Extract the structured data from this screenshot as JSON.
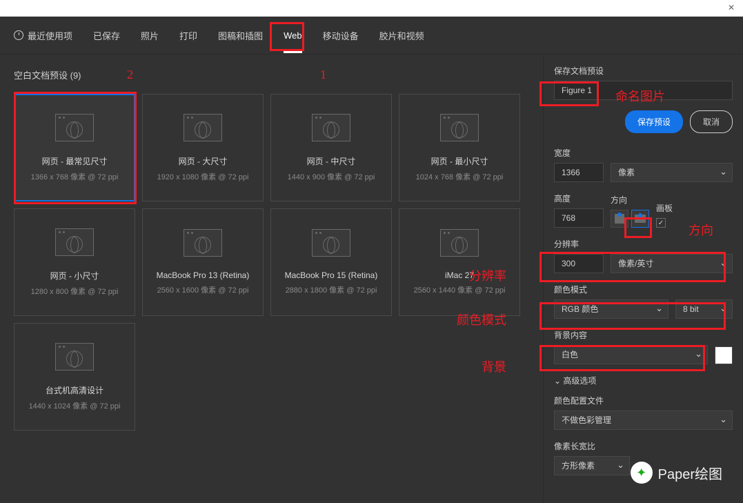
{
  "titlebar": {
    "close": "✕"
  },
  "tabs": {
    "recent": "最近使用项",
    "saved": "已保存",
    "photo": "照片",
    "print": "打印",
    "art": "图稿和插图",
    "web": "Web",
    "mobile": "移动设备",
    "film": "胶片和视频"
  },
  "section": {
    "title": "空白文档预设 (9)"
  },
  "presets": [
    {
      "title": "网页 - 最常见尺寸",
      "sub": "1366 x 768 像素 @ 72 ppi"
    },
    {
      "title": "网页 - 大尺寸",
      "sub": "1920 x 1080 像素 @ 72 ppi"
    },
    {
      "title": "网页 - 中尺寸",
      "sub": "1440 x 900 像素 @ 72 ppi"
    },
    {
      "title": "网页 - 最小尺寸",
      "sub": "1024 x 768 像素 @ 72 ppi"
    },
    {
      "title": "网页 - 小尺寸",
      "sub": "1280 x 800 像素 @ 72 ppi"
    },
    {
      "title": "MacBook Pro 13 (Retina)",
      "sub": "2560 x 1600 像素 @ 72 ppi"
    },
    {
      "title": "MacBook Pro 15 (Retina)",
      "sub": "2880 x 1800 像素 @ 72 ppi"
    },
    {
      "title": "iMac 27",
      "sub": "2560 x 1440 像素 @ 72 ppi"
    },
    {
      "title": "台式机高清设计",
      "sub": "1440 x 1024 像素 @ 72 ppi"
    }
  ],
  "panel": {
    "save_preset_label": "保存文档预设",
    "name": "Figure 1",
    "save_btn": "保存预设",
    "cancel_btn": "取消",
    "width_label": "宽度",
    "width": "1366",
    "unit": "像素",
    "height_label": "高度",
    "height": "768",
    "orient_label": "方向",
    "artboard_label": "画板",
    "artboard_check": "✓",
    "res_label": "分辨率",
    "res": "300",
    "res_unit": "像素/英寸",
    "mode_label": "颜色模式",
    "mode": "RGB 颜色",
    "bit": "8 bit",
    "bg_label": "背景内容",
    "bg": "白色",
    "adv": "高级选项",
    "profile_label": "颜色配置文件",
    "profile": "不做色彩管理",
    "aspect_label": "像素长宽比",
    "aspect": "方形像素"
  },
  "annotations": {
    "num1": "1",
    "num2": "2",
    "naming": "命名图片",
    "resolution": "分辨率",
    "colormode": "颜色模式",
    "background": "背景",
    "orientation": "方向"
  },
  "watermark": "Paper绘图"
}
